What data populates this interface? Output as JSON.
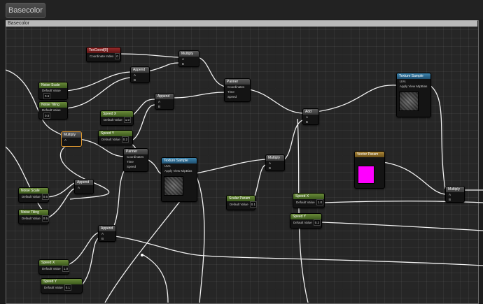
{
  "tab": {
    "label": "Basecolor"
  },
  "panel": {
    "title": "Basecolor"
  },
  "labels": {
    "coordinates": "Coordinates",
    "time": "Time",
    "speed": "Speed",
    "uvs": "UVs",
    "apply_view_mip": "Apply View MipBias",
    "rgb": "RGB",
    "rgba": "RGBA",
    "r": "R",
    "g": "G",
    "b": "B",
    "a": "A",
    "default_value": "Default Value"
  },
  "nodes": {
    "texcoord": {
      "title": "TexCoord[0]",
      "row": "Coordinate Index"
    },
    "multiply": "Multiply",
    "append": "Append",
    "panner": "Panner",
    "add": "Add",
    "texture_sample": "Texture Sample",
    "constant": "Constant",
    "param_labels": [
      "Noise Scale",
      "Noise Tiling",
      "Speed X",
      "Speed Y",
      "Vector Param",
      "Scalar Param"
    ],
    "values": [
      "0",
      "0.6",
      "0.5",
      "1.0",
      "0.2",
      "0.1"
    ]
  }
}
